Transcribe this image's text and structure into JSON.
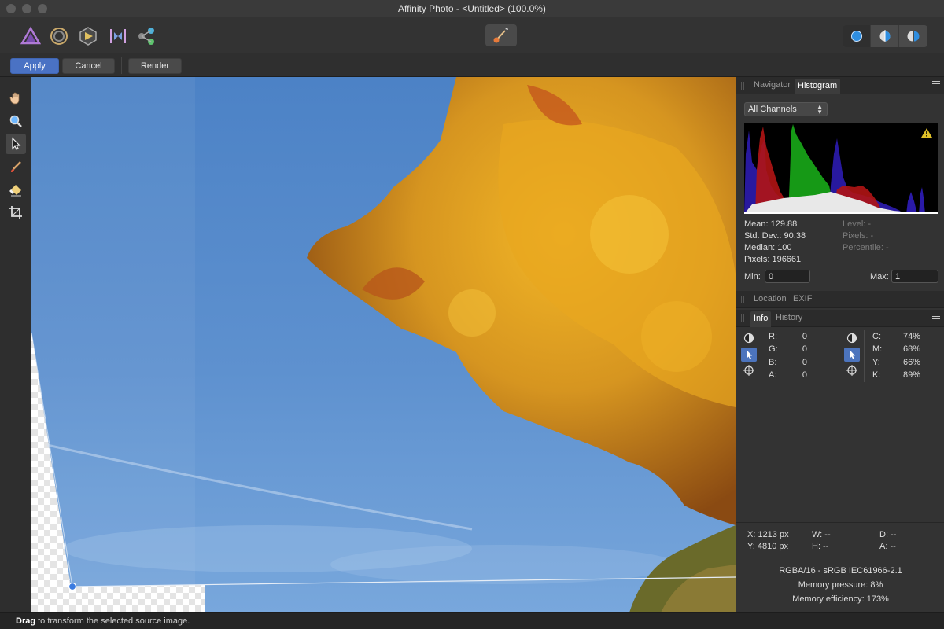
{
  "window": {
    "title": "Affinity Photo - <Untitled> (100.0%)"
  },
  "toolbar": {
    "personas": [
      "photo-persona",
      "liquify-persona",
      "develop-persona",
      "tone-mapping-persona",
      "export-persona"
    ],
    "center_tool": "liquify-brush",
    "view_modes": [
      "view-mode-full",
      "view-mode-split",
      "view-mode-mirror"
    ]
  },
  "context_bar": {
    "apply": "Apply",
    "cancel": "Cancel",
    "render": "Render"
  },
  "tools": [
    "hand-tool",
    "zoom-tool",
    "move-tool",
    "brush-tool",
    "eraser-tool",
    "crop-tool"
  ],
  "panels": {
    "top_tabs": {
      "navigator": "Navigator",
      "histogram": "Histogram"
    },
    "histogram": {
      "channel": "All Channels",
      "mean": "Mean: 129.88",
      "stddev": "Std. Dev.: 90.38",
      "median": "Median: 100",
      "pixels": "Pixels: 196661",
      "level": "Level: -",
      "pixels_right": "Pixels: -",
      "percentile": "Percentile: -",
      "min_label": "Min:",
      "min_value": "0",
      "max_label": "Max:",
      "max_value": "1"
    },
    "mid_tabs": {
      "location": "Location",
      "exif": "EXIF"
    },
    "info_tabs": {
      "info": "Info",
      "history": "History"
    },
    "info": {
      "rgb": [
        {
          "label": "R:",
          "value": "0"
        },
        {
          "label": "G:",
          "value": "0"
        },
        {
          "label": "B:",
          "value": "0"
        },
        {
          "label": "A:",
          "value": "0"
        }
      ],
      "cmyk": [
        {
          "label": "C:",
          "value": "74%"
        },
        {
          "label": "M:",
          "value": "68%"
        },
        {
          "label": "Y:",
          "value": "66%"
        },
        {
          "label": "K:",
          "value": "89%"
        }
      ],
      "x": "X: 1213 px",
      "y": "Y: 4810 px",
      "w": "W: --",
      "h": "H: --",
      "d": "D: --",
      "a": "A: --",
      "color_format": "RGBA/16 - sRGB IEC61966-2.1",
      "memory_pressure": "Memory pressure: 8%",
      "memory_efficiency": "Memory efficiency: 173%"
    }
  },
  "status": {
    "bold": "Drag",
    "rest": " to transform the selected source image."
  },
  "colors": {
    "accent": "#4a72c4",
    "sky": "#5b8bc9",
    "foliage": "#d59a1c"
  }
}
